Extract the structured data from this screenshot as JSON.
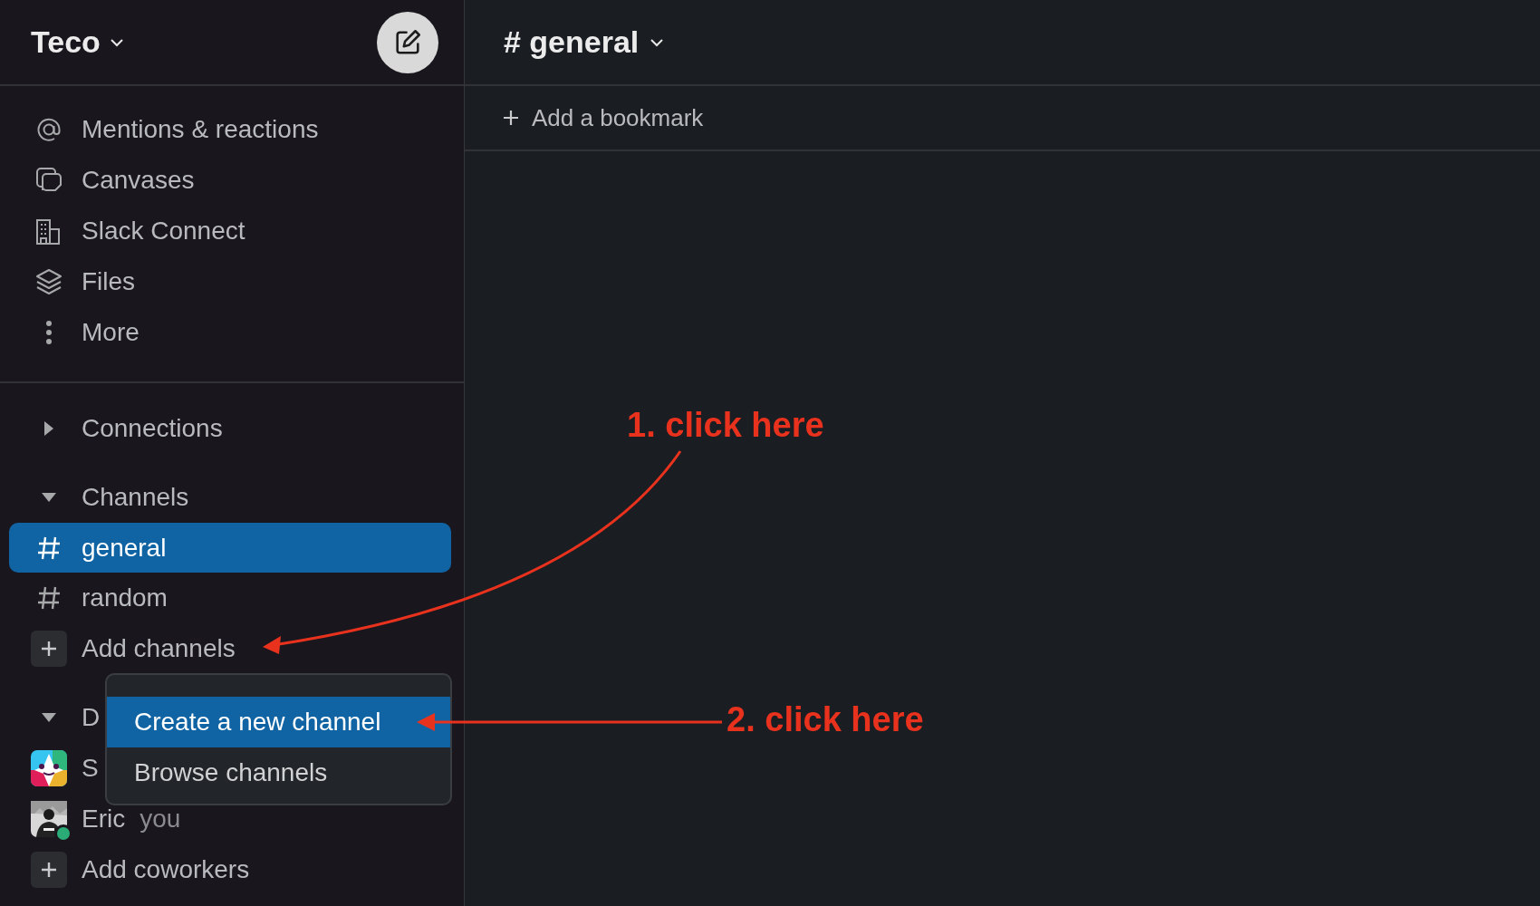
{
  "workspace": {
    "name": "Teco"
  },
  "nav": [
    {
      "label": "Mentions & reactions"
    },
    {
      "label": "Canvases"
    },
    {
      "label": "Slack Connect"
    },
    {
      "label": "Files"
    },
    {
      "label": "More"
    }
  ],
  "sections": [
    {
      "title": "Connections",
      "expanded": false
    },
    {
      "title": "Channels",
      "expanded": true,
      "items": [
        {
          "kind": "channel",
          "label": "general",
          "selected": true
        },
        {
          "kind": "channel",
          "label": "random",
          "selected": false
        },
        {
          "kind": "add",
          "label": "Add channels"
        }
      ]
    },
    {
      "title": "D",
      "expanded": true,
      "items": [
        {
          "kind": "app",
          "label": "S"
        },
        {
          "kind": "user",
          "label": "Eric",
          "note": "you",
          "online": true
        },
        {
          "kind": "add",
          "label": "Add coworkers"
        }
      ]
    }
  ],
  "menu": {
    "items": [
      {
        "label": "Create a new channel",
        "selected": true
      },
      {
        "label": "Browse channels",
        "selected": false
      }
    ]
  },
  "channel_header": {
    "title": "# general"
  },
  "bookmark_bar": {
    "label": "Add a bookmark"
  },
  "annotations": [
    {
      "text": "1. click here"
    },
    {
      "text": "2. click here"
    }
  ]
}
